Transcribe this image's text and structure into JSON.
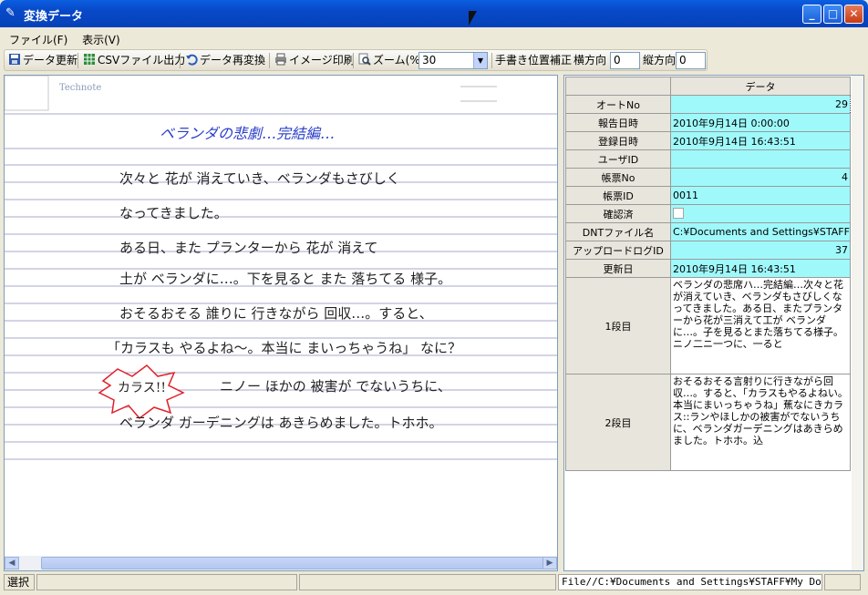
{
  "window": {
    "title": "変換データ"
  },
  "menu": {
    "file": "ファイル(F)",
    "view": "表示(V)"
  },
  "toolbar": {
    "update": "データ更新",
    "csv": "CSVファイル出力",
    "reconvert": "データ再変換",
    "print": "イメージ印刷",
    "zoom_label": "ズーム(%)",
    "zoom_value": "30",
    "correction_label": "手書き位置補正",
    "horizontal_label": "横方向",
    "horizontal_value": "0",
    "vertical_label": "縦方向",
    "vertical_value": "0"
  },
  "paper": {
    "brand": "Technote",
    "title": "ベランダの悲劇…完結編…",
    "lines": [
      "次々と 花が 消えていき、ベランダもさびしく",
      "なってきました。",
      "ある日、また プランターから 花が 消えて",
      "土が ベランダに…。下を見ると また 落ちてる 様子。",
      "おそるおそる 誰りに 行きながら 回収…。すると、",
      "「カラスも やるよね〜。本当に まいっちゃうね」 なに？",
      "ニノー ほかの 被害が でないうちに、",
      "ベランダ ガーデニングは あきらめました。トホホ。"
    ],
    "burst": "カラス!!"
  },
  "table": {
    "header": "データ",
    "rows": [
      {
        "label": "オートNo",
        "value": "29",
        "align": "r"
      },
      {
        "label": "報告日時",
        "value": "2010年9月14日  0:00:00",
        "align": "l"
      },
      {
        "label": "登録日時",
        "value": "2010年9月14日  16:43:51",
        "align": "l"
      },
      {
        "label": "ユーザID",
        "value": "",
        "align": "l"
      },
      {
        "label": "帳票No",
        "value": "4",
        "align": "r"
      },
      {
        "label": "帳票ID",
        "value": "0011",
        "align": "l"
      },
      {
        "label": "確認済",
        "value": "",
        "align": "l"
      },
      {
        "label": "DNTファイル名",
        "value": "C:¥Documents and Settings¥STAFF¥M",
        "align": "l"
      },
      {
        "label": "アップロードログID",
        "value": "37",
        "align": "r"
      },
      {
        "label": "更新日",
        "value": "2010年9月14日  16:43:51",
        "align": "l"
      }
    ],
    "memo1": {
      "label": "1段目",
      "value": "ベランダの悲席ハ…完結編…次々と花が消えていき、ベランダもさびしくなってきました。ある日、またプランターから花が三消えて工が ベランダに…。子を見るとまた落ちてる様子。ニノ二ニ一つに、一ると"
    },
    "memo2": {
      "label": "2段目",
      "value": "おそるおそる言射りに行きながら回収…。すると、「カラスもやるよねい。本当にまいっちゃうね」蕉なにきカラス::ランやほしかの被害がでないうちに、ベランダガーデニングはあきらめました。トホホ。込"
    }
  },
  "status": {
    "left": "選択",
    "path": "File//C:¥Documents and Settings¥STAFF¥My Documen"
  }
}
